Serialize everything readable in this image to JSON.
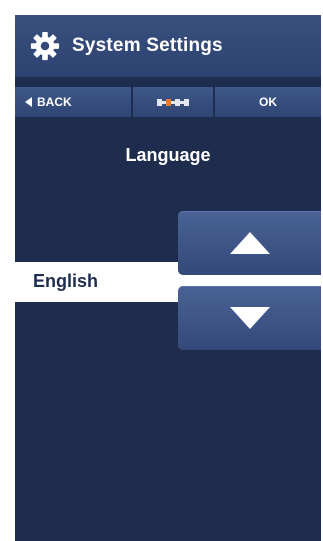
{
  "header": {
    "title": "System Settings",
    "icon": "gear-icon"
  },
  "toolbar": {
    "back_label": "BACK",
    "ok_label": "OK",
    "progress_steps": 3,
    "progress_current_step": 1,
    "accent_color": "#f07a20"
  },
  "section": {
    "title": "Language"
  },
  "selector": {
    "selected_value": "English",
    "up_icon": "triangle-up-icon",
    "down_icon": "triangle-down-icon"
  },
  "colors": {
    "background": "#1e2d4e",
    "header": "#34497a",
    "button": "#3f5889",
    "selected_row": "#ffffff"
  }
}
